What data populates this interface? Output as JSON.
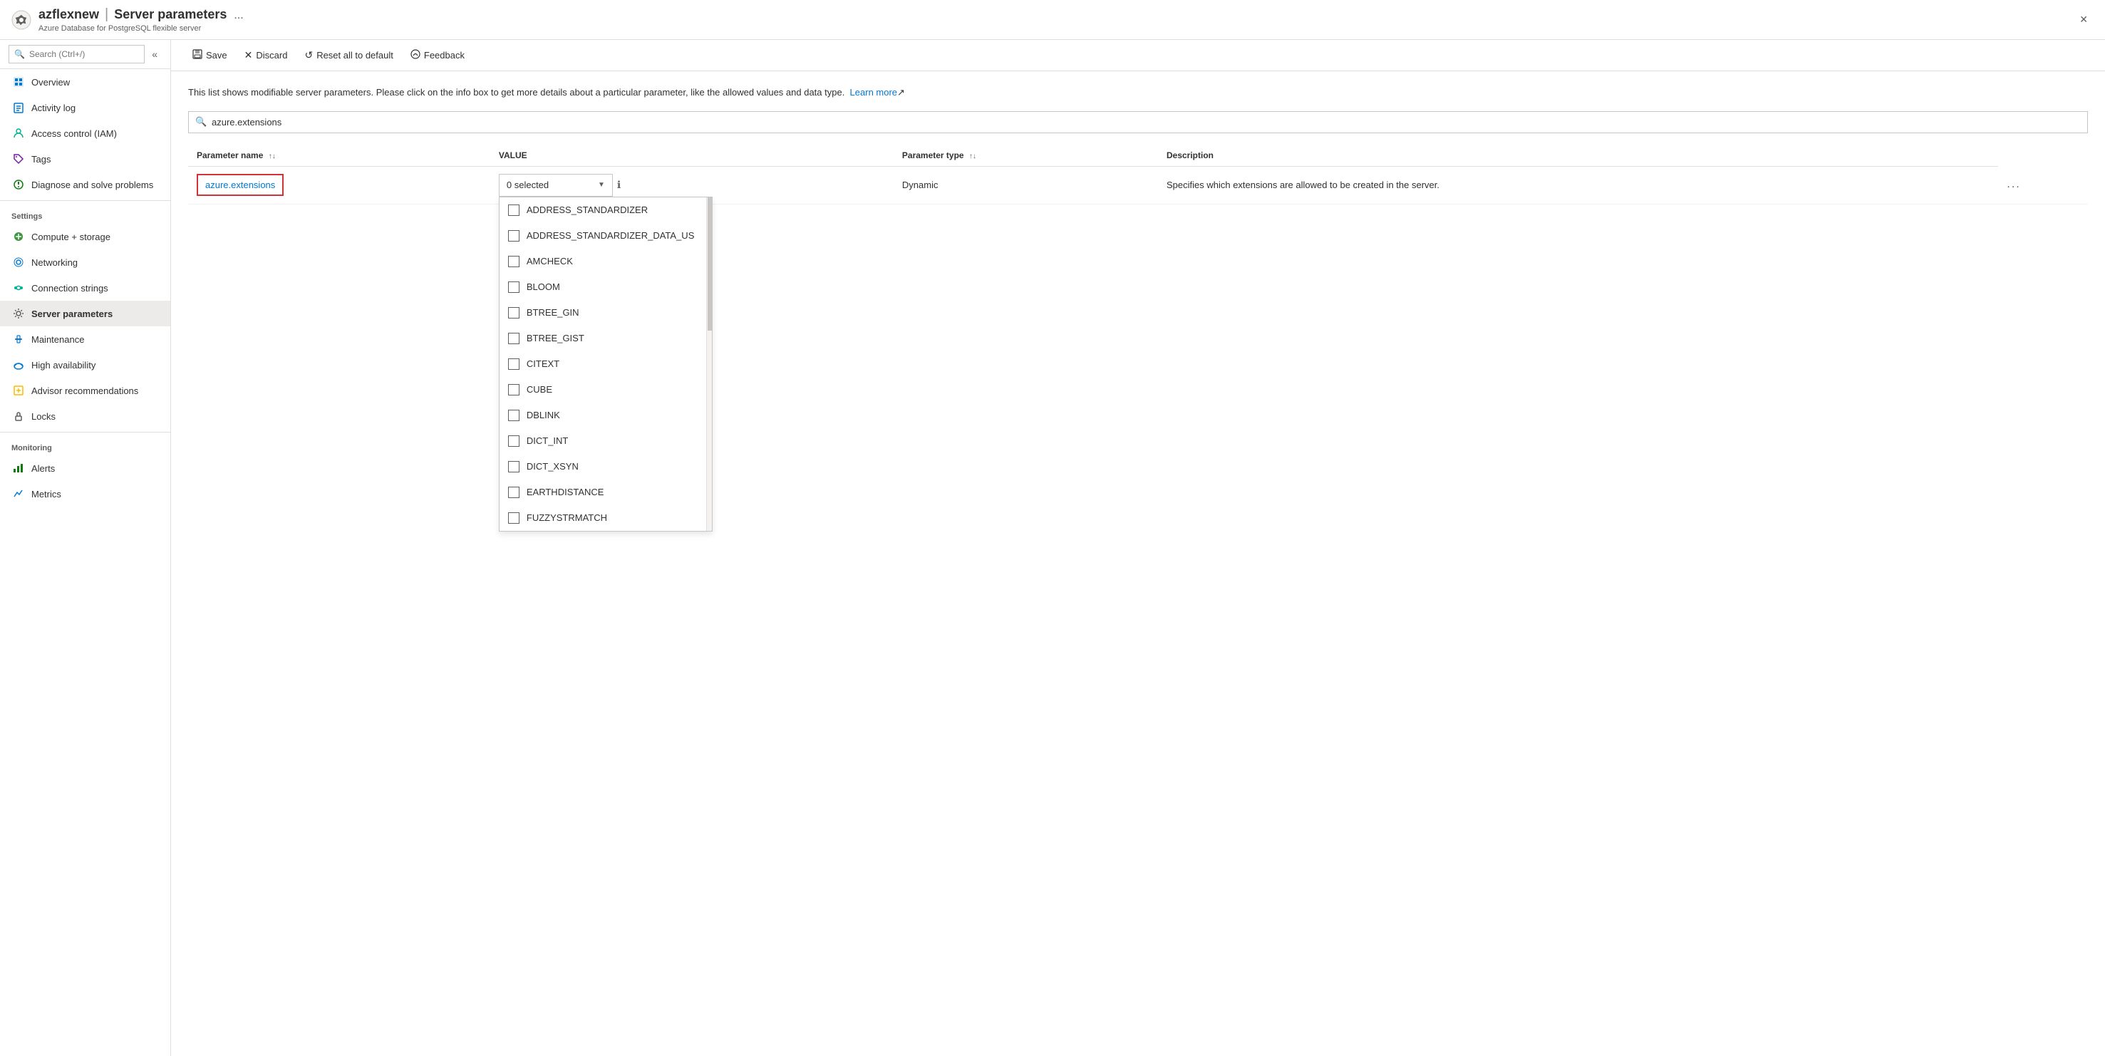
{
  "titleBar": {
    "icon": "gear",
    "resourceName": "azflexnew",
    "separator": "|",
    "pageTitle": "Server parameters",
    "ellipsis": "...",
    "subtitle": "Azure Database for PostgreSQL flexible server",
    "closeLabel": "✕"
  },
  "sidebar": {
    "searchPlaceholder": "Search (Ctrl+/)",
    "collapseLabel": "«",
    "items": [
      {
        "id": "overview",
        "label": "Overview",
        "icon": "square-blue",
        "active": false
      },
      {
        "id": "activity-log",
        "label": "Activity log",
        "icon": "doc-blue",
        "active": false
      },
      {
        "id": "access-control",
        "label": "Access control (IAM)",
        "icon": "person-teal",
        "active": false
      },
      {
        "id": "tags",
        "label": "Tags",
        "icon": "tag-purple",
        "active": false
      },
      {
        "id": "diagnose",
        "label": "Diagnose and solve problems",
        "icon": "wrench-green",
        "active": false
      }
    ],
    "settingsSection": "Settings",
    "settingsItems": [
      {
        "id": "compute-storage",
        "label": "Compute + storage",
        "icon": "circle-green",
        "active": false
      },
      {
        "id": "networking",
        "label": "Networking",
        "icon": "network-blue",
        "active": false
      },
      {
        "id": "connection-strings",
        "label": "Connection strings",
        "icon": "lightning-teal",
        "active": false
      },
      {
        "id": "server-parameters",
        "label": "Server parameters",
        "icon": "gear-gray",
        "active": true
      },
      {
        "id": "maintenance",
        "label": "Maintenance",
        "icon": "tools-blue",
        "active": false
      },
      {
        "id": "high-availability",
        "label": "High availability",
        "icon": "cloud-blue",
        "active": false
      },
      {
        "id": "advisor",
        "label": "Advisor recommendations",
        "icon": "lock-yellow",
        "active": false
      },
      {
        "id": "locks",
        "label": "Locks",
        "icon": "lock-gray",
        "active": false
      }
    ],
    "monitoringSection": "Monitoring",
    "monitoringItems": [
      {
        "id": "alerts",
        "label": "Alerts",
        "icon": "bar-green",
        "active": false
      },
      {
        "id": "metrics",
        "label": "Metrics",
        "icon": "chart-blue",
        "active": false
      }
    ]
  },
  "toolbar": {
    "saveLabel": "Save",
    "discardLabel": "Discard",
    "resetLabel": "Reset all to default",
    "feedbackLabel": "Feedback"
  },
  "content": {
    "description": "This list shows modifiable server parameters. Please click on the info box to get more details about a particular parameter, like the allowed values and data type.",
    "learnMoreLabel": "Learn more",
    "searchPlaceholder": "azure.extensions",
    "tableHeaders": {
      "paramName": "Parameter name",
      "value": "VALUE",
      "paramType": "Parameter type",
      "description": "Description"
    },
    "row": {
      "paramName": "azure.extensions",
      "dropdownLabel": "0 selected",
      "paramType": "Dynamic",
      "description": "Specifies which extensions are allowed to be created in the server.",
      "moreOptions": "..."
    },
    "dropdownOptions": [
      {
        "id": "address_standardizer",
        "label": "ADDRESS_STANDARDIZER",
        "checked": false
      },
      {
        "id": "address_standardizer_data_us",
        "label": "ADDRESS_STANDARDIZER_DATA_US",
        "checked": false
      },
      {
        "id": "amcheck",
        "label": "AMCHECK",
        "checked": false
      },
      {
        "id": "bloom",
        "label": "BLOOM",
        "checked": false
      },
      {
        "id": "btree_gin",
        "label": "BTREE_GIN",
        "checked": false
      },
      {
        "id": "btree_gist",
        "label": "BTREE_GIST",
        "checked": false
      },
      {
        "id": "citext",
        "label": "CITEXT",
        "checked": false
      },
      {
        "id": "cube",
        "label": "CUBE",
        "checked": false
      },
      {
        "id": "dblink",
        "label": "DBLINK",
        "checked": false
      },
      {
        "id": "dict_int",
        "label": "DICT_INT",
        "checked": false
      },
      {
        "id": "dict_xsyn",
        "label": "DICT_XSYN",
        "checked": false
      },
      {
        "id": "earthdistance",
        "label": "EARTHDISTANCE",
        "checked": false
      },
      {
        "id": "fuzzystrmatch",
        "label": "FUZZYSTRMATCH",
        "checked": false
      }
    ]
  }
}
